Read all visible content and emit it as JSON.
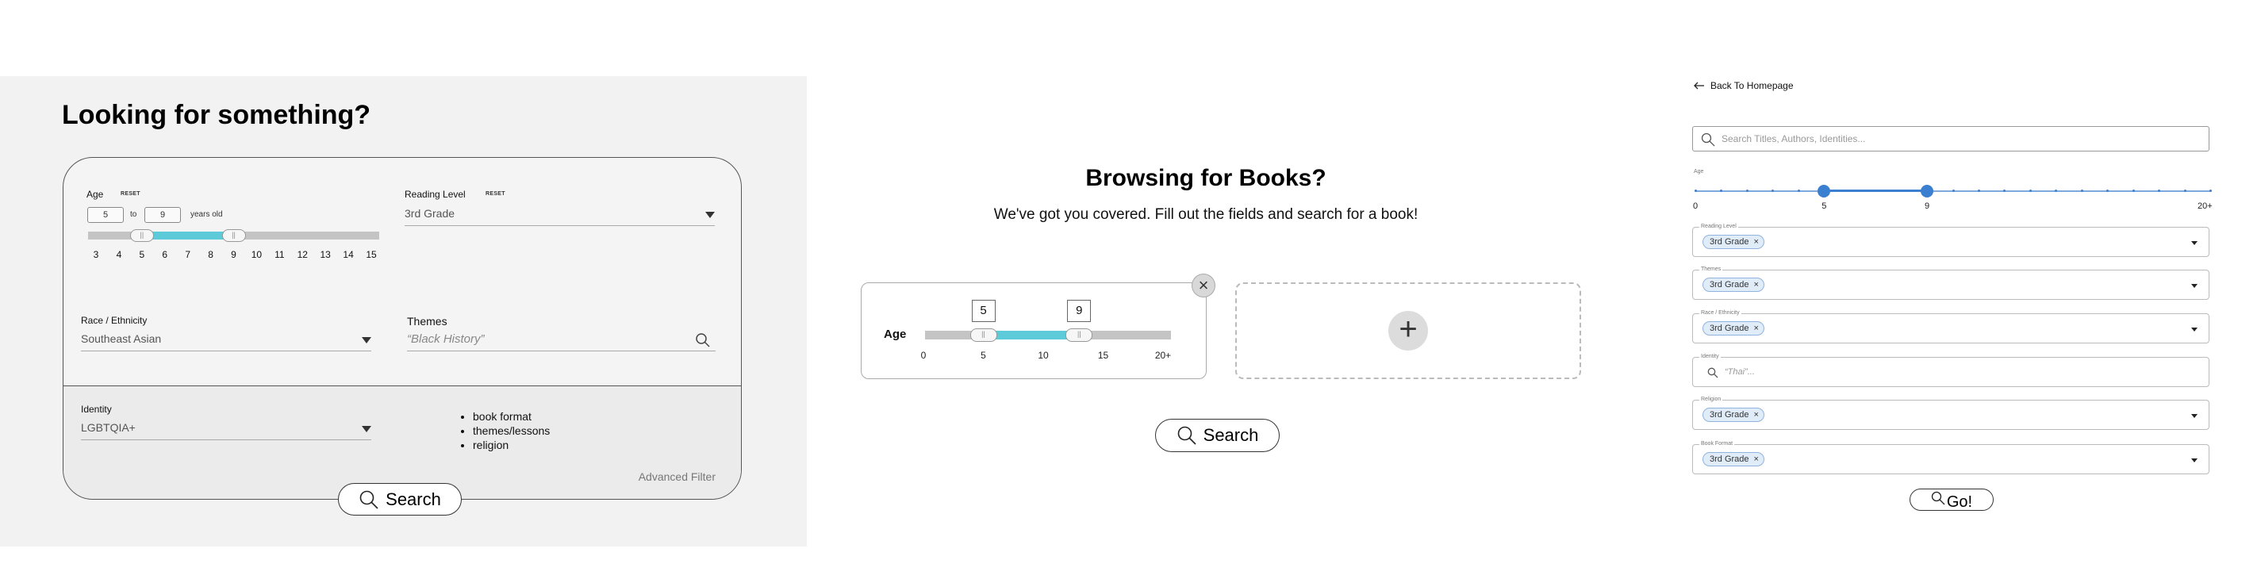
{
  "panel1": {
    "title": "Looking for something?",
    "age": {
      "label": "Age",
      "reset": "RESET",
      "min": "5",
      "to": "to",
      "max": "9",
      "unit": "years old",
      "ticks": [
        "3",
        "4",
        "5",
        "6",
        "7",
        "8",
        "9",
        "10",
        "11",
        "12",
        "13",
        "14",
        "15"
      ],
      "range_min": 3,
      "range_max": 15,
      "selected_min": 5,
      "selected_max": 9
    },
    "reading_level": {
      "label": "Reading Level",
      "reset": "RESET",
      "value": "3rd Grade"
    },
    "race": {
      "label": "Race /  Ethnicity",
      "value": "Southeast Asian"
    },
    "themes": {
      "label": "Themes",
      "placeholder": "“Black History”"
    },
    "identity": {
      "label": "Identity",
      "value": "LGBTQIA+"
    },
    "more_filters": [
      "book format",
      "themes/lessons",
      "religion"
    ],
    "advanced_filter": "Advanced Filter",
    "search_button": "Search"
  },
  "panel2": {
    "title": "Browsing for Books?",
    "subtitle": "We've got you covered. Fill out the fields and search for a book!",
    "age": {
      "label": "Age",
      "min": "5",
      "max": "9",
      "ticks": [
        "0",
        "5",
        "10",
        "15",
        "20+"
      ],
      "selected_min": 5,
      "selected_max": 13
    },
    "close_glyph": "×",
    "add_glyph": "+",
    "search_button": "Search"
  },
  "panel3": {
    "back_link": "Back To Homepage",
    "search_placeholder": "Search Titles, Authors, Identities...",
    "age": {
      "label": "Age",
      "ticks": [
        "0",
        "5",
        "9",
        "20+"
      ]
    },
    "fields": [
      {
        "label": "Reading Level",
        "chip": "3rd Grade"
      },
      {
        "label": "Themes",
        "chip": "3rd Grade"
      },
      {
        "label": "Race / Ethnicity",
        "chip": "3rd Grade"
      }
    ],
    "identity": {
      "label": "Identity",
      "placeholder": "“Thai”..."
    },
    "fields2": [
      {
        "label": "Religion",
        "chip": "3rd Grade"
      },
      {
        "label": "Book Format",
        "chip": "3rd Grade"
      }
    ],
    "chip_remove": "×",
    "go_button": "Go!"
  },
  "colors": {
    "slider_fill": "#5ccad8",
    "slider_blue": "#3b7fd0",
    "chip_bg": "#e0ecf8"
  },
  "icons": [
    "search-icon",
    "close-icon",
    "plus-icon",
    "chevron-down-icon",
    "arrow-left-icon",
    "slider-handle-icon"
  ]
}
